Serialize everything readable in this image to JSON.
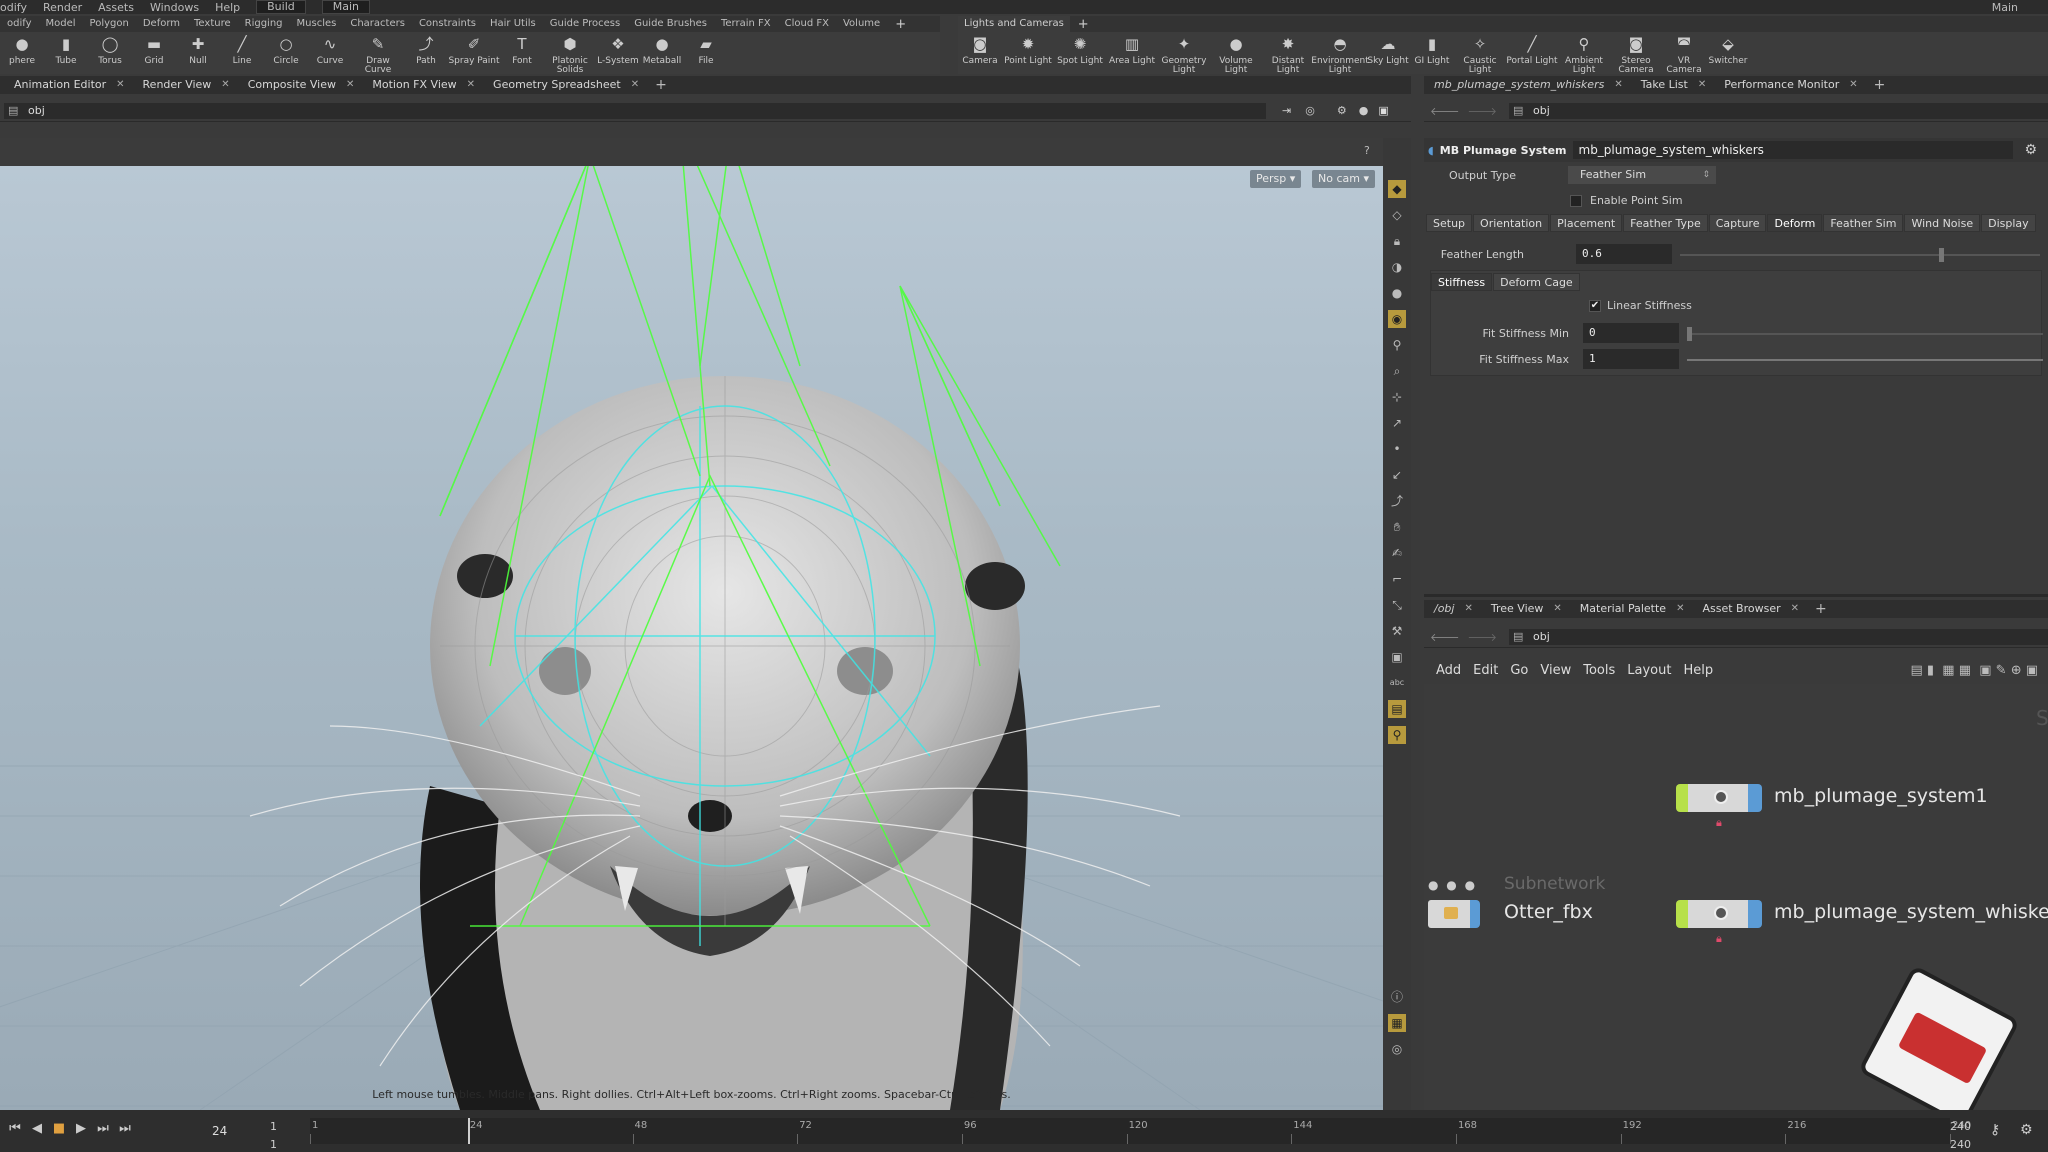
{
  "menu": {
    "items": [
      "odify",
      "Render",
      "Assets",
      "Windows",
      "Help"
    ],
    "desktop": "Build",
    "main": "Main",
    "right_main": "Main"
  },
  "shelf_left": {
    "tabs": [
      "odify",
      "Model",
      "Polygon",
      "Deform",
      "Texture",
      "Rigging",
      "Muscles",
      "Characters",
      "Constraints",
      "Hair Utils",
      "Guide Process",
      "Guide Brushes",
      "Terrain FX",
      "Cloud FX",
      "Volume"
    ],
    "tools": [
      {
        "label": "phere",
        "icon": "sphere-icon",
        "glyph": "●"
      },
      {
        "label": "Tube",
        "icon": "tube-icon",
        "glyph": "▮"
      },
      {
        "label": "Torus",
        "icon": "torus-icon",
        "glyph": "◯"
      },
      {
        "label": "Grid",
        "icon": "grid-icon",
        "glyph": "▬"
      },
      {
        "label": "Null",
        "icon": "null-icon",
        "glyph": "✚"
      },
      {
        "label": "Line",
        "icon": "line-icon",
        "glyph": "╱"
      },
      {
        "label": "Circle",
        "icon": "circle-icon",
        "glyph": "○"
      },
      {
        "label": "Curve",
        "icon": "curve-icon",
        "glyph": "∿"
      },
      {
        "label": "Draw Curve",
        "icon": "draw-curve-icon",
        "glyph": "✎"
      },
      {
        "label": "Path",
        "icon": "path-icon",
        "glyph": "⤴"
      },
      {
        "label": "Spray Paint",
        "icon": "spray-paint-icon",
        "glyph": "✐"
      },
      {
        "label": "Font",
        "icon": "font-icon",
        "glyph": "T"
      },
      {
        "label": "Platonic Solids",
        "icon": "platonic-icon",
        "glyph": "⬢"
      },
      {
        "label": "L-System",
        "icon": "lsystem-icon",
        "glyph": "❖"
      },
      {
        "label": "Metaball",
        "icon": "metaball-icon",
        "glyph": "●"
      },
      {
        "label": "File",
        "icon": "file-icon",
        "glyph": "▰"
      }
    ]
  },
  "shelf_right": {
    "tabs": [
      "Lights and Cameras"
    ],
    "tools": [
      {
        "label": "Camera",
        "icon": "camera-icon",
        "glyph": "◙"
      },
      {
        "label": "Point Light",
        "icon": "point-light-icon",
        "glyph": "✹"
      },
      {
        "label": "Spot Light",
        "icon": "spot-light-icon",
        "glyph": "✺"
      },
      {
        "label": "Area Light",
        "icon": "area-light-icon",
        "glyph": "▥"
      },
      {
        "label": "Geometry Light",
        "icon": "geometry-light-icon",
        "glyph": "✦"
      },
      {
        "label": "Volume Light",
        "icon": "volume-light-icon",
        "glyph": "●"
      },
      {
        "label": "Distant Light",
        "icon": "distant-light-icon",
        "glyph": "✸"
      },
      {
        "label": "Environment Light",
        "icon": "environment-light-icon",
        "glyph": "◓"
      },
      {
        "label": "Sky Light",
        "icon": "sky-light-icon",
        "glyph": "☁"
      },
      {
        "label": "GI Light",
        "icon": "gi-light-icon",
        "glyph": "▮"
      },
      {
        "label": "Caustic Light",
        "icon": "caustic-light-icon",
        "glyph": "✧"
      },
      {
        "label": "Portal Light",
        "icon": "portal-light-icon",
        "glyph": "╱"
      },
      {
        "label": "Ambient Light",
        "icon": "ambient-light-icon",
        "glyph": "⚲"
      },
      {
        "label": "Stereo Camera",
        "icon": "stereo-camera-icon",
        "glyph": "◙"
      },
      {
        "label": "VR Camera",
        "icon": "vr-camera-icon",
        "glyph": "◚"
      },
      {
        "label": "Switcher",
        "icon": "switcher-icon",
        "glyph": "⬙"
      }
    ]
  },
  "left_pane": {
    "tabs": [
      "Animation Editor",
      "Render View",
      "Composite View",
      "Motion FX View",
      "Geometry Spreadsheet"
    ],
    "path": "obj",
    "persp": "Persp ▾",
    "cam": "No cam ▾",
    "status": "Left mouse tumbles. Middle pans. Right dollies. Ctrl+Alt+Left box-zooms. Ctrl+Right zooms. Spacebar-Ctrl-Left tilts."
  },
  "param_pane": {
    "tabs": [
      "mb_plumage_system_whiskers",
      "Take List",
      "Performance Monitor"
    ],
    "path": "obj",
    "node_type": "MB Plumage System",
    "node_name": "mb_plumage_system_whiskers",
    "output_type_label": "Output Type",
    "output_type_value": "Feather Sim",
    "enable_point_sim_label": "Enable Point Sim",
    "tabs2": [
      "Setup",
      "Orientation",
      "Placement",
      "Feather Type",
      "Capture",
      "Deform",
      "Feather Sim",
      "Wind Noise",
      "Display"
    ],
    "feather_length_label": "Feather Length",
    "feather_length_value": "0.6",
    "feather_length_fraction": 0.72,
    "subtabs": [
      "Stiffness",
      "Deform Cage"
    ],
    "linear_stiffness_label": "Linear Stiffness",
    "linear_stiffness_checked": true,
    "fit_min_label": "Fit Stiffness Min",
    "fit_min_value": "0",
    "fit_max_label": "Fit Stiffness Max",
    "fit_max_value": "1"
  },
  "net_pane": {
    "tabs": [
      "/obj",
      "Tree View",
      "Material Palette",
      "Asset Browser"
    ],
    "path": "obj",
    "menu": [
      "Add",
      "Edit",
      "Go",
      "View",
      "Tools",
      "Layout",
      "Help"
    ],
    "nodes": {
      "plumage1": "mb_plumage_system1",
      "whiskers": "mb_plumage_system_whiskers",
      "otter_type": "Subnetwork",
      "otter": "Otter_fbx"
    },
    "corner_letter": "S"
  },
  "timeline": {
    "current_frame": "24",
    "start": "1",
    "start2": "1",
    "ticks": [
      "1",
      "24",
      "48",
      "72",
      "96",
      "120",
      "144",
      "168",
      "192",
      "216",
      "240"
    ],
    "end": "240",
    "end2": "240",
    "playhead_frame": 24,
    "range_end": 240
  },
  "colors": {
    "node_green": "#b7e04a",
    "node_blue": "#5b9bd5",
    "viewport_bg": "#aebecb",
    "guide_green": "#4dff3a",
    "guide_cyan": "#3ee6e6"
  }
}
